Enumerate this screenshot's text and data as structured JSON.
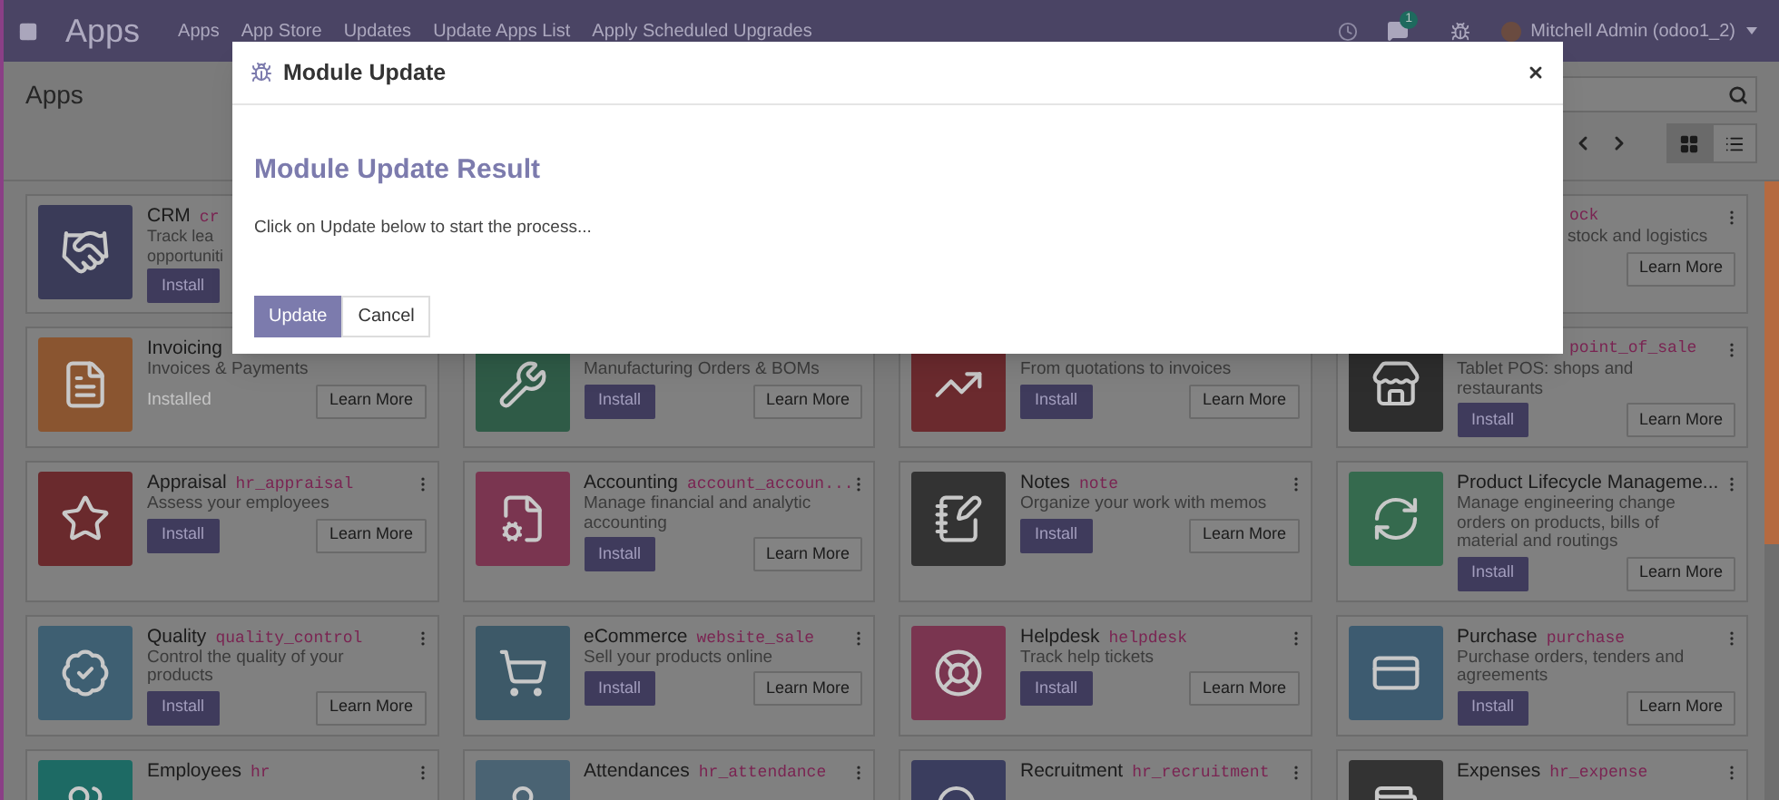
{
  "navbar": {
    "brand": "Apps",
    "menu": [
      "Apps",
      "App Store",
      "Updates",
      "Update Apps List",
      "Apply Scheduled Upgrades"
    ],
    "chat_badge": "1",
    "user": "Mitchell Admin (odoo1_2)"
  },
  "control_panel": {
    "title": "Apps",
    "views": [
      {
        "kind": "kanban",
        "selected": true
      },
      {
        "kind": "list",
        "selected": false
      }
    ]
  },
  "cards": [
    {
      "kind": "plain",
      "name": "CRM",
      "code": "cr",
      "description_lines": [
        "Track lea",
        "opportuniti"
      ],
      "color": "#3a3b58",
      "action": {
        "kind": "install",
        "label": "Install"
      }
    },
    {
      "kind": "shifted",
      "code": "ock",
      "description": "stock and logistics",
      "learn_more": "Learn More",
      "menu": true
    },
    {
      "kind": "plain",
      "name": "Invoicing",
      "description": "Invoices & Payments",
      "color": "#8a5530",
      "action": {
        "kind": "installed",
        "label": "Installed"
      },
      "learn_more": "Learn More"
    },
    {
      "kind": "plain",
      "description": "Manufacturing Orders & BOMs",
      "color": "#2f5b47",
      "action": {
        "kind": "install",
        "label": "Install"
      },
      "learn_more": "Learn More"
    },
    {
      "kind": "plain",
      "description": "From quotations to invoices",
      "color": "#6b2a2e",
      "action": {
        "kind": "install",
        "label": "Install"
      },
      "learn_more": "Learn More"
    },
    {
      "kind": "header_shifted",
      "code": "point_of_sale",
      "description": "Tablet POS: shops and restaurants",
      "color": "#2d2d2d",
      "action": {
        "kind": "install",
        "label": "Install"
      },
      "learn_more": "Learn More",
      "menu": true
    },
    {
      "kind": "plain",
      "name": "Appraisal",
      "code": "hr_appraisal",
      "description": "Assess your employees",
      "color": "#6a2a2d",
      "action": {
        "kind": "install",
        "label": "Install"
      },
      "learn_more": "Learn More",
      "menu": true
    },
    {
      "kind": "plain",
      "name": "Accounting",
      "code": "account_accoun...",
      "description": "Manage financial and analytic accounting",
      "color": "#7a3550",
      "action": {
        "kind": "install",
        "label": "Install"
      },
      "learn_more": "Learn More",
      "menu": true
    },
    {
      "kind": "plain",
      "name": "Notes",
      "code": "note",
      "description": "Organize your work with memos",
      "color": "#333333",
      "action": {
        "kind": "install",
        "label": "Install"
      },
      "learn_more": "Learn More",
      "menu": true
    },
    {
      "kind": "plain",
      "name": "Product Lifecycle Manageme...",
      "description": "Manage engineering change orders on products, bills of material and routings",
      "color": "#356a4e",
      "action": {
        "kind": "install",
        "label": "Install"
      },
      "learn_more": "Learn More",
      "menu": true
    },
    {
      "kind": "plain",
      "name": "Quality",
      "code": "quality_control",
      "description": "Control the quality of your products",
      "color": "#3e5f72",
      "action": {
        "kind": "install",
        "label": "Install"
      },
      "learn_more": "Learn More",
      "menu": true
    },
    {
      "kind": "plain",
      "name": "eCommerce",
      "code": "website_sale",
      "description": "Sell your products online",
      "color": "#3d5968",
      "action": {
        "kind": "install",
        "label": "Install"
      },
      "learn_more": "Learn More",
      "menu": true
    },
    {
      "kind": "plain",
      "name": "Helpdesk",
      "code": "helpdesk",
      "description": "Track help tickets",
      "color": "#7a3550",
      "action": {
        "kind": "install",
        "label": "Install"
      },
      "learn_more": "Learn More",
      "menu": true
    },
    {
      "kind": "plain",
      "name": "Purchase",
      "code": "purchase",
      "description": "Purchase orders, tenders and agreements",
      "color": "#3d5b70",
      "action": {
        "kind": "install",
        "label": "Install"
      },
      "learn_more": "Learn More",
      "menu": true
    },
    {
      "kind": "plain",
      "name": "Employees",
      "code": "hr",
      "color": "#1d6a64",
      "menu": true
    },
    {
      "kind": "plain",
      "name": "Attendances",
      "code": "hr_attendance",
      "color": "#4a6373",
      "menu": true
    },
    {
      "kind": "plain",
      "name": "Recruitment",
      "code": "hr_recruitment",
      "color": "#3a3d5e",
      "menu": true
    },
    {
      "kind": "plain",
      "name": "Expenses",
      "code": "hr_expense",
      "color": "#333333",
      "menu": true
    }
  ],
  "dialog": {
    "title": "Module Update",
    "heading": "Module Update Result",
    "message": "Click on Update below to start the process...",
    "buttons": [
      {
        "kind": "primary",
        "label": "Update"
      },
      {
        "kind": "secondary",
        "label": "Cancel"
      }
    ]
  }
}
